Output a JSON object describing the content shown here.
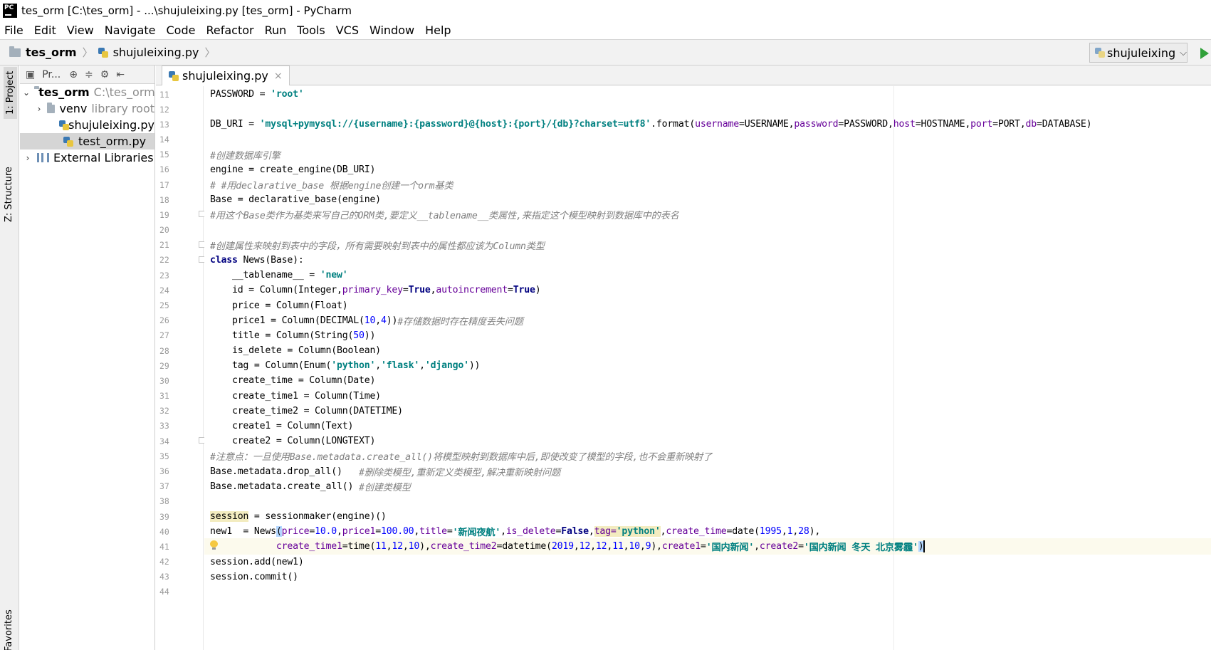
{
  "window": {
    "title": "tes_orm [C:\\tes_orm] - ...\\shujuleixing.py [tes_orm] - PyCharm",
    "logo_text": "PC"
  },
  "menu": [
    "File",
    "Edit",
    "View",
    "Navigate",
    "Code",
    "Refactor",
    "Run",
    "Tools",
    "VCS",
    "Window",
    "Help"
  ],
  "breadcrumb": {
    "project": "tes_orm",
    "file": "shujuleixing.py",
    "separator": "〉"
  },
  "run_config": {
    "name": "shujuleixing",
    "chevron": "⌵"
  },
  "side_tabs": {
    "project": "1: Project",
    "structure": "Z: Structure",
    "favorites": "Favorites"
  },
  "project_panel": {
    "toolbar_label": "Pr...",
    "tree": [
      {
        "name": "tes_orm",
        "hint": "C:\\tes_orm",
        "arrow": "⌄",
        "kind": "folder",
        "bold": true
      },
      {
        "name": "venv",
        "hint": "library root",
        "arrow": "›",
        "kind": "folder"
      },
      {
        "name": "shujuleixing.py",
        "hint": "",
        "arrow": "",
        "kind": "py"
      },
      {
        "name": "test_orm.py",
        "hint": "",
        "arrow": "",
        "kind": "py",
        "selected": true
      },
      {
        "name": "External Libraries",
        "hint": "",
        "arrow": "›",
        "kind": "lib"
      }
    ]
  },
  "editor": {
    "tab_label": "shujuleixing.py",
    "tab_close": "×",
    "current_line": 41,
    "lines": [
      {
        "n": 11,
        "t": [
          [
            "PASSWORD = ",
            ""
          ],
          [
            "'root'",
            "str"
          ]
        ]
      },
      {
        "n": 12,
        "t": []
      },
      {
        "n": 13,
        "t": [
          [
            "DB_URI = ",
            ""
          ],
          [
            "'mysql+pymysql://{username}:{password}@{host}:{port}/{db}?charset=utf8'",
            "str"
          ],
          [
            ".format(",
            ""
          ],
          [
            "username",
            "kwarg"
          ],
          [
            "=USERNAME,",
            ""
          ],
          [
            "password",
            "kwarg"
          ],
          [
            "=PASSWORD,",
            ""
          ],
          [
            "host",
            "kwarg"
          ],
          [
            "=HOSTNAME,",
            ""
          ],
          [
            "port",
            "kwarg"
          ],
          [
            "=PORT,",
            ""
          ],
          [
            "db",
            "kwarg"
          ],
          [
            "=DATABASE)",
            ""
          ]
        ]
      },
      {
        "n": 14,
        "t": []
      },
      {
        "n": 15,
        "t": [
          [
            "#创建数据库引擎",
            "cmt"
          ]
        ]
      },
      {
        "n": 16,
        "t": [
          [
            "engine = create_engine(DB_URI)",
            ""
          ]
        ]
      },
      {
        "n": 17,
        "t": [
          [
            "# #用declarative_base 根据engine创建一个orm基类",
            "cmt"
          ]
        ]
      },
      {
        "n": 18,
        "t": [
          [
            "Base = declarative_base(engine)",
            ""
          ]
        ]
      },
      {
        "n": 19,
        "t": [
          [
            "#用这个Base类作为基类来写自己的ORM类,要定义__tablename__类属性,来指定这个模型映射到数据库中的表名",
            "cmt"
          ]
        ],
        "fold": true
      },
      {
        "n": 20,
        "t": []
      },
      {
        "n": 21,
        "t": [
          [
            "#创建属性来映射到表中的字段，所有需要映射到表中的属性都应该为Column类型",
            "cmt"
          ]
        ],
        "fold": true
      },
      {
        "n": 22,
        "t": [
          [
            "class",
            "kw"
          ],
          [
            " News(Base):",
            ""
          ]
        ],
        "fold": true
      },
      {
        "n": 23,
        "t": [
          [
            "    __tablename__ = ",
            ""
          ],
          [
            "'new'",
            "str"
          ]
        ]
      },
      {
        "n": 24,
        "t": [
          [
            "    id = Column(Integer,",
            ""
          ],
          [
            "primary_key",
            "kwarg"
          ],
          [
            "=",
            ""
          ],
          [
            "True",
            "kw"
          ],
          [
            ",",
            ""
          ],
          [
            "autoincrement",
            "kwarg"
          ],
          [
            "=",
            ""
          ],
          [
            "True",
            "kw"
          ],
          [
            ")",
            ""
          ]
        ]
      },
      {
        "n": 25,
        "t": [
          [
            "    price = Column(Float)",
            ""
          ]
        ]
      },
      {
        "n": 26,
        "t": [
          [
            "    price1 = Column(DECIMAL(",
            ""
          ],
          [
            "10",
            "num"
          ],
          [
            ",",
            ""
          ],
          [
            "4",
            "num"
          ],
          [
            "))",
            ""
          ],
          [
            "#存储数据时存在精度丢失问题",
            "cmt"
          ]
        ]
      },
      {
        "n": 27,
        "t": [
          [
            "    title = Column(String(",
            ""
          ],
          [
            "50",
            "num"
          ],
          [
            "))",
            ""
          ]
        ]
      },
      {
        "n": 28,
        "t": [
          [
            "    is_delete = Column(Boolean)",
            ""
          ]
        ]
      },
      {
        "n": 29,
        "t": [
          [
            "    tag = Column(Enum(",
            ""
          ],
          [
            "'python'",
            "str"
          ],
          [
            ",",
            ""
          ],
          [
            "'flask'",
            "str"
          ],
          [
            ",",
            ""
          ],
          [
            "'django'",
            "str"
          ],
          [
            "))",
            ""
          ]
        ]
      },
      {
        "n": 30,
        "t": [
          [
            "    create_time = Column(Date)",
            ""
          ]
        ]
      },
      {
        "n": 31,
        "t": [
          [
            "    create_time1 = Column(Time)",
            ""
          ]
        ]
      },
      {
        "n": 32,
        "t": [
          [
            "    create_time2 = Column(DATETIME)",
            ""
          ]
        ]
      },
      {
        "n": 33,
        "t": [
          [
            "    create1 = Column(Text)",
            ""
          ]
        ]
      },
      {
        "n": 34,
        "t": [
          [
            "    create2 = Column(LONGTEXT)",
            ""
          ]
        ],
        "fold": true
      },
      {
        "n": 35,
        "t": [
          [
            "#注意点：一旦使用Base.metadata.create_all()将模型映射到数据库中后,即使改变了模型的字段,也不会重新映射了",
            "cmt"
          ]
        ]
      },
      {
        "n": 36,
        "t": [
          [
            "Base.metadata.drop_all()   ",
            ""
          ],
          [
            "#删除类模型,重新定义类模型,解决重新映射问题",
            "cmt"
          ]
        ]
      },
      {
        "n": 37,
        "t": [
          [
            "Base.metadata.create_all() ",
            ""
          ],
          [
            "#创建类模型",
            "cmt"
          ]
        ]
      },
      {
        "n": 38,
        "t": []
      },
      {
        "n": 39,
        "t": [
          [
            "session",
            "hl"
          ],
          [
            " = sessionmaker(engine)()",
            ""
          ]
        ]
      },
      {
        "n": 40,
        "t": [
          [
            "new1  = News",
            ""
          ],
          [
            "(",
            "match"
          ],
          [
            "price",
            "kwarg"
          ],
          [
            "=",
            ""
          ],
          [
            "10.0",
            "num"
          ],
          [
            ",",
            ""
          ],
          [
            "price1",
            "kwarg"
          ],
          [
            "=",
            ""
          ],
          [
            "100.00",
            "num"
          ],
          [
            ",",
            ""
          ],
          [
            "title",
            "kwarg"
          ],
          [
            "=",
            ""
          ],
          [
            "'新闻夜航'",
            "str"
          ],
          [
            ",",
            ""
          ],
          [
            "is_delete",
            "kwarg"
          ],
          [
            "=",
            ""
          ],
          [
            "False",
            "kw"
          ],
          [
            ",",
            ""
          ],
          [
            "tag=",
            "kwarg hl"
          ],
          [
            "'python'",
            "str hl"
          ],
          [
            ",",
            ""
          ],
          [
            "create_time",
            "kwarg"
          ],
          [
            "=date(",
            ""
          ],
          [
            "1995",
            "num"
          ],
          [
            ",",
            ""
          ],
          [
            "1",
            "num"
          ],
          [
            ",",
            ""
          ],
          [
            "28",
            "num"
          ],
          [
            "),",
            ""
          ]
        ]
      },
      {
        "n": 41,
        "t": [
          [
            "            ",
            ""
          ],
          [
            "create_time1",
            "kwarg"
          ],
          [
            "=time(",
            ""
          ],
          [
            "11",
            "num"
          ],
          [
            ",",
            ""
          ],
          [
            "12",
            "num"
          ],
          [
            ",",
            ""
          ],
          [
            "10",
            "num"
          ],
          [
            "),",
            ""
          ],
          [
            "create_time2",
            "kwarg"
          ],
          [
            "=datetime(",
            ""
          ],
          [
            "2019",
            "num"
          ],
          [
            ",",
            ""
          ],
          [
            "12",
            "num"
          ],
          [
            ",",
            ""
          ],
          [
            "12",
            "num"
          ],
          [
            ",",
            ""
          ],
          [
            "11",
            "num"
          ],
          [
            ",",
            ""
          ],
          [
            "10",
            "num"
          ],
          [
            ",",
            ""
          ],
          [
            "9",
            "num"
          ],
          [
            "),",
            ""
          ],
          [
            "create1",
            "kwarg"
          ],
          [
            "=",
            ""
          ],
          [
            "'国内新闻'",
            "str"
          ],
          [
            ",",
            ""
          ],
          [
            "create2",
            "kwarg"
          ],
          [
            "=",
            ""
          ],
          [
            "'国内新闻 冬天 北京雾霾'",
            "str"
          ],
          [
            ")",
            "match"
          ]
        ],
        "bulb": true,
        "caret": true
      },
      {
        "n": 42,
        "t": [
          [
            "session.add(new1)",
            ""
          ]
        ]
      },
      {
        "n": 43,
        "t": [
          [
            "session.commit()",
            ""
          ]
        ]
      },
      {
        "n": 44,
        "t": []
      }
    ]
  }
}
